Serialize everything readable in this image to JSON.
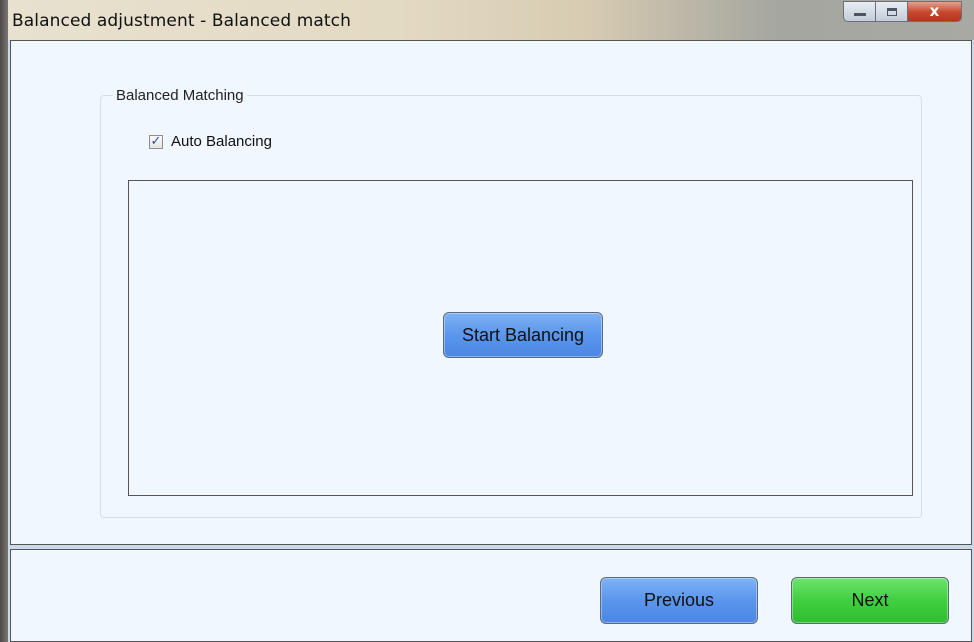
{
  "window": {
    "title": "Balanced adjustment - Balanced match",
    "controls": {
      "close_glyph": "x"
    }
  },
  "groupbox": {
    "legend": "Balanced Matching",
    "auto_balancing": {
      "label": "Auto Balancing",
      "checked": true
    },
    "start_button_label": "Start Balancing"
  },
  "footer": {
    "previous_label": "Previous",
    "next_label": "Next"
  },
  "colors": {
    "panel_bg": "#f0f7fe",
    "blue_button": "#5a96ec",
    "green_button": "#3fcf3f",
    "close_button": "#c7452d"
  },
  "icons": {
    "minimize": "minimize-icon",
    "maximize": "maximize-icon",
    "close": "close-icon",
    "checkbox": "checkmark-icon"
  }
}
